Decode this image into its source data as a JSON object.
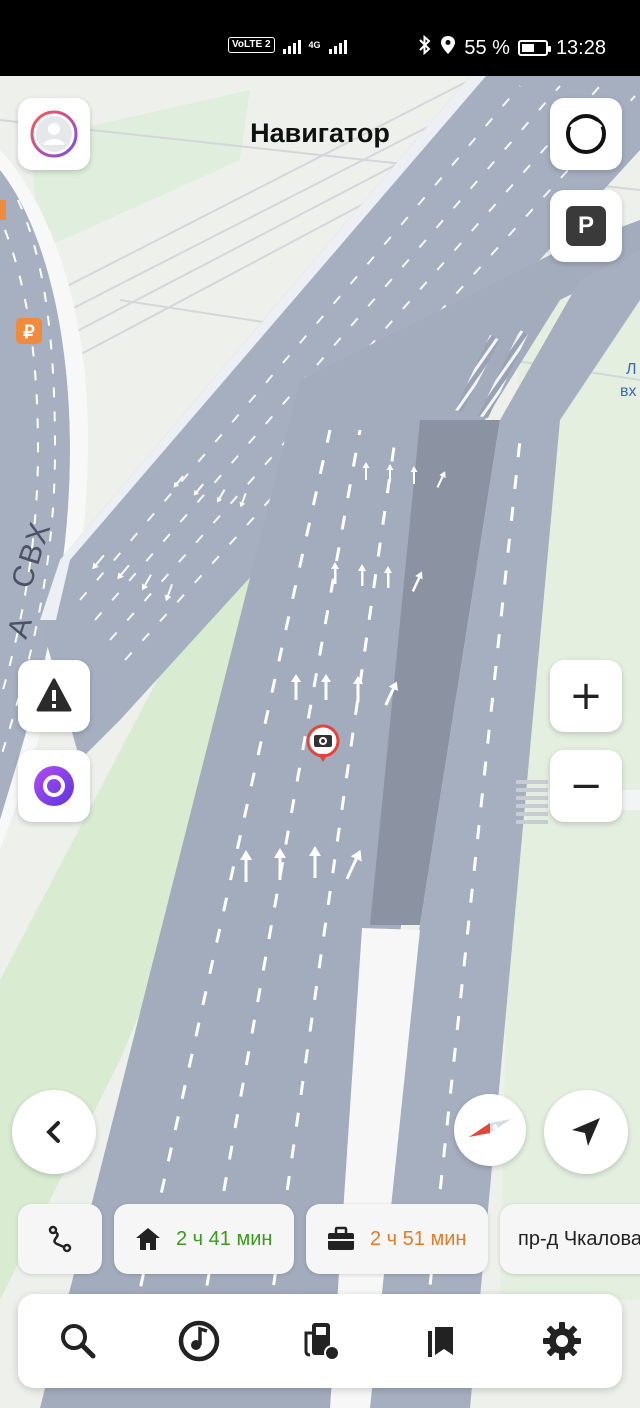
{
  "status_bar": {
    "volte": "VoLTE",
    "sim": "2",
    "net": "4G",
    "battery_pct": "55 %",
    "time": "13:28",
    "battery_level": 0.55
  },
  "header": {
    "title": "Навигатор"
  },
  "map": {
    "road_label": "СВХ",
    "road_label_prefix": "А",
    "poi_label_line1": "Л",
    "poi_label_line2": "вх",
    "ruble_icon": "ruble-marker-icon",
    "camera_icon": "speed-camera-icon"
  },
  "controls": {
    "parking_label": "P",
    "zoom_in": "+",
    "zoom_out": "−"
  },
  "chips": [
    {
      "icon": "home-icon",
      "label": "2 ч 41 мин",
      "color": "#3a9a1e"
    },
    {
      "icon": "briefcase-icon",
      "label": "2 ч 51 мин",
      "color": "#e07c2a"
    },
    {
      "icon": "",
      "label": "пр-д Чкалова"
    }
  ],
  "bottom_nav": [
    {
      "icon": "search-icon"
    },
    {
      "icon": "music-icon"
    },
    {
      "icon": "fuel-station-icon"
    },
    {
      "icon": "bookmarks-icon"
    },
    {
      "icon": "settings-icon"
    }
  ]
}
